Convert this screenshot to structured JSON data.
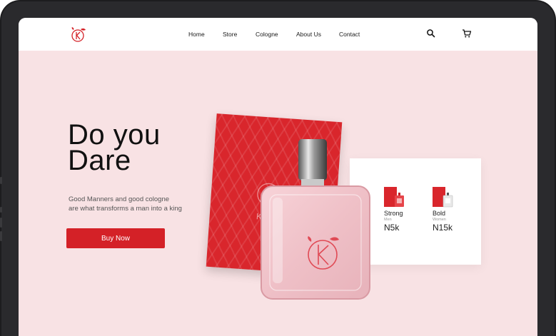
{
  "nav": {
    "links": [
      "Home",
      "Store",
      "Cologne",
      "About Us",
      "Contact"
    ],
    "icons": [
      "search-icon",
      "cart-icon"
    ]
  },
  "hero": {
    "headline_line1": "Do you",
    "headline_line2": "Dare",
    "tagline_line1": "Good Manners and good cologne",
    "tagline_line2": "are what transforms a man into a king",
    "button_label": "Buy Now"
  },
  "box": {
    "brand": "Kiya"
  },
  "products": [
    {
      "name": "Strong",
      "sub": "Men",
      "price": "N5k"
    },
    {
      "name": "Bold",
      "sub": "Women",
      "price": "N15k"
    }
  ],
  "colors": {
    "accent": "#d42127",
    "background": "#f8e2e4",
    "nav": "#ffffff",
    "bottle_glass": "#f3c7cd"
  }
}
